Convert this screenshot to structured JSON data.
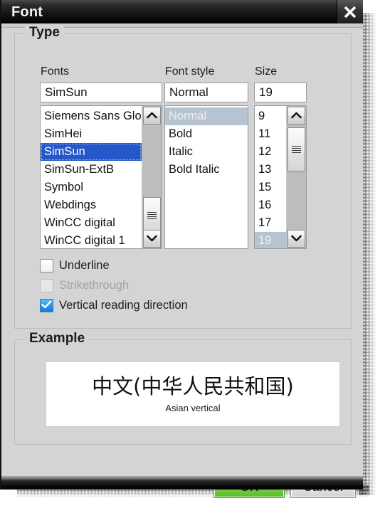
{
  "window": {
    "title": "Font",
    "close_icon": "close-icon"
  },
  "groups": {
    "type": {
      "title": "Type"
    },
    "example": {
      "title": "Example"
    }
  },
  "fonts": {
    "label": "Fonts",
    "value": "SimSun",
    "items": [
      "Siemens Sans Glo...",
      "SimHei",
      "SimSun",
      "SimSun-ExtB",
      "Symbol",
      "Webdings",
      "WinCC digital",
      "WinCC digital 1"
    ],
    "selected": "SimSun",
    "selected_index": 2,
    "scrollbar": {
      "up_icon": "chevron-up-icon",
      "down_icon": "chevron-down-icon",
      "thumb_icon": "scrollbar-grip-icon"
    }
  },
  "font_style": {
    "label": "Font style",
    "value": "Normal",
    "items": [
      "Normal",
      "Bold",
      "Italic",
      "Bold Italic"
    ],
    "selected": "Normal",
    "selected_index": 0
  },
  "size": {
    "label": "Size",
    "value": "19",
    "items": [
      "9",
      "11",
      "12",
      "13",
      "15",
      "16",
      "17",
      "19"
    ],
    "selected": "19",
    "selected_index": 7,
    "scrollbar": {
      "up_icon": "chevron-up-icon",
      "down_icon": "chevron-down-icon",
      "thumb_icon": "scrollbar-grip-icon"
    }
  },
  "checkboxes": [
    {
      "label": "Underline",
      "checked": false,
      "disabled": false,
      "name": "underline"
    },
    {
      "label": "Strikethrough",
      "checked": false,
      "disabled": true,
      "name": "strikethrough"
    },
    {
      "label": "Vertical reading direction",
      "checked": true,
      "disabled": false,
      "name": "vertical-reading-direction"
    }
  ],
  "example": {
    "main_text": "中文(中华人民共和国)",
    "sub_text": "Asian vertical"
  },
  "buttons": {
    "ok": "OK",
    "cancel": "Cancel"
  },
  "colors": {
    "selection_active": "#2458c8",
    "selection_inactive": "#b6c4d2",
    "ok_accent": "#72ca3f",
    "checkbox_accent": "#2b8fe0",
    "window_bg": "#d4d4d4",
    "titlebar_bg": "#141414"
  }
}
